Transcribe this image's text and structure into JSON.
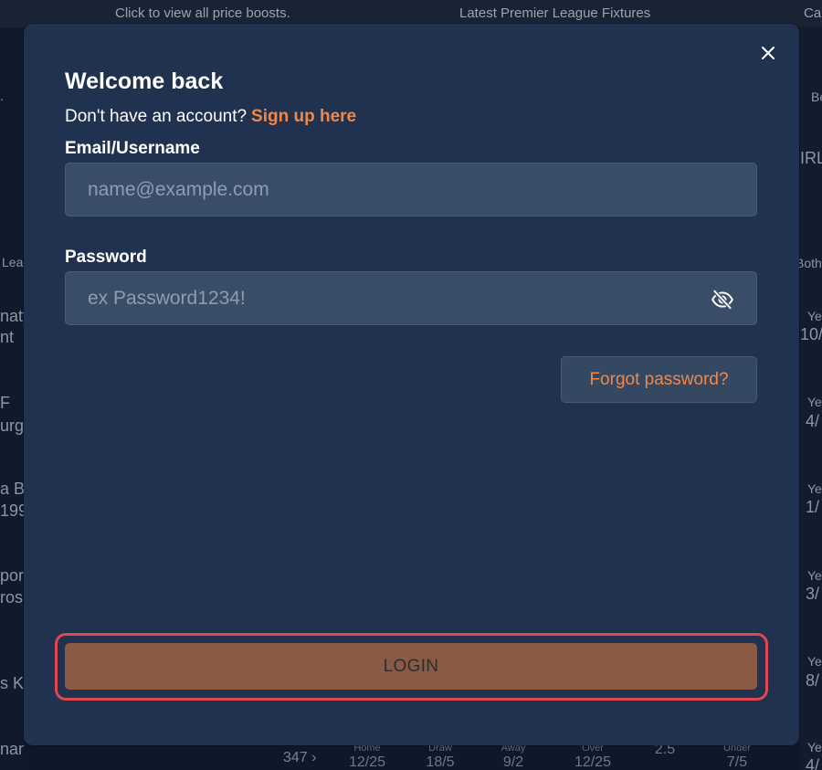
{
  "background": {
    "banner_left": "Click to view all price boosts.",
    "banner_center": "Latest Premier League Fixtures",
    "banner_right": "Ca",
    "left_fragments": [
      ".",
      "Lea",
      "naty",
      "nt",
      "F",
      "urg",
      "a B",
      "199",
      "por",
      "ros",
      "s K",
      "nan"
    ],
    "right_fragments": [
      "Be",
      "IRL",
      "Both",
      "Ye",
      "10/",
      "Ye",
      "4/",
      "Ye",
      "1/",
      "Ye",
      "3/",
      "Ye",
      "8/",
      "Ye",
      "4/"
    ],
    "bottom_row": {
      "market_count": "347",
      "cells": [
        {
          "label": "Home",
          "value": "12/25"
        },
        {
          "label": "Draw",
          "value": "18/5"
        },
        {
          "label": "Away",
          "value": "9/2"
        },
        {
          "label": "Over",
          "value": "12/25"
        },
        {
          "label": "",
          "value": "2.5"
        },
        {
          "label": "Under",
          "value": "7/5"
        }
      ]
    }
  },
  "modal": {
    "title": "Welcome back",
    "signup_prompt": "Don't have an account?",
    "signup_link": "Sign up here",
    "email_label": "Email/Username",
    "email_value": "",
    "email_placeholder": "name@example.com",
    "password_label": "Password",
    "password_value": "",
    "password_placeholder": "ex Password1234!",
    "forgot_label": "Forgot password?",
    "login_label": "LOGIN",
    "icons": {
      "close": "close-icon",
      "password_toggle": "eye-off-icon"
    }
  },
  "colors": {
    "modal_bg": "#203250",
    "accent": "#f0884a",
    "login_bg": "#8a5a44",
    "focus_ring": "#e0474f",
    "input_bg": "#3a4d68"
  }
}
